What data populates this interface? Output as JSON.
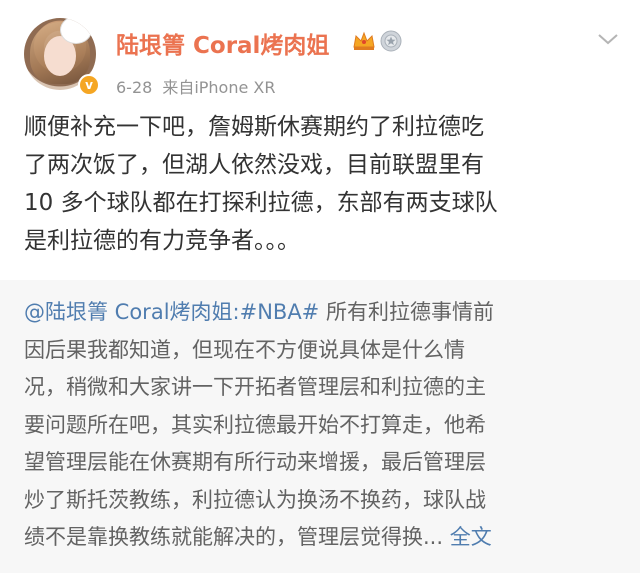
{
  "post": {
    "author": {
      "name": "陆垠箐 Coral烤肉姐",
      "avatar_icon": "user-avatar",
      "verified_icon": "verified-badge-icon",
      "vip_icon": "crown-icon",
      "medal_icon": "medal-icon"
    },
    "meta": {
      "date": "6-28",
      "source": "来自iPhone XR"
    },
    "text_lines": [
      "顺便补充一下吧，詹姆斯休赛期约了利拉德吃",
      "了两次饭了，但湖人依然没戏，目前联盟里有",
      "10 多个球队都在打探利拉德，东部有两支球队",
      "是利拉德的有力竞争者。。。"
    ],
    "menu_icon": "chevron-down-icon"
  },
  "repost": {
    "mention": "@陆垠箐 Coral烤肉姐",
    "separator": ":",
    "topic": "#NBA#",
    "line1_rest": " 所有利拉德事情前",
    "lines": [
      "因后果我都知道，但现在不方便说具体是什么情",
      "况，稍微和大家讲一下开拓者管理层和利拉德的主",
      "要问题所在吧，其实利拉德最开始不打算走，他希",
      "望管理层能在休赛期有所行动来增援，最后管理层",
      "炒了斯托茨教练，利拉德认为换汤不换药，球队战"
    ],
    "last_line": "绩不是靠换教练就能解决的，管理层觉得换... ",
    "full_text_link": "全文"
  },
  "colors": {
    "username": "#eb7350",
    "link": "#507daf",
    "meta": "#939393",
    "body_text": "#333333",
    "repost_text": "#636363",
    "repost_bg": "#f7f7f7"
  }
}
